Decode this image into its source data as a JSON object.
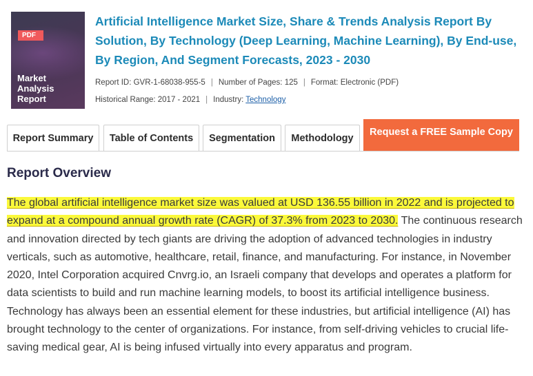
{
  "cover": {
    "badge": "PDF",
    "title_lines": [
      "Market",
      "Analysis",
      "Report"
    ]
  },
  "report": {
    "title": "Artificial Intelligence Market Size, Share & Trends Analysis Report By Solution, By Technology (Deep Learning, Machine Learning), By End-use, By Region, And Segment Forecasts, 2023 - 2030",
    "report_id": "Report ID: GVR-1-68038-955-5",
    "pages": "Number of Pages: 125",
    "format": "Format: Electronic (PDF)",
    "historical_range": "Historical Range: 2017 - 2021",
    "industry_label": "Industry:",
    "industry_link": "Technology",
    "separator": "|"
  },
  "tabs": [
    {
      "label": "Report Summary"
    },
    {
      "label": "Table of Contents"
    },
    {
      "label": "Segmentation"
    },
    {
      "label": "Methodology"
    }
  ],
  "cta": {
    "label": "Request a FREE Sample Copy"
  },
  "overview": {
    "title": "Report Overview",
    "highlight": "The global artificial intelligence market size was valued at USD 136.55 billion in 2022 and is projected to expand at a compound annual growth rate (CAGR) of 37.3% from 2023 to 2030.",
    "rest": " The continuous research and innovation directed by tech giants are driving the adoption of advanced technologies in industry verticals, such as automotive, healthcare, retail, finance, and manufacturing. For instance, in November 2020, Intel Corporation acquired Cnvrg.io, an Israeli company that develops and operates a platform for data scientists to build and run machine learning models, to boost its artificial intelligence business. Technology has always been an essential element for these industries, but artificial intelligence (AI) has brought technology to the center of organizations. For instance, from self-driving vehicles to crucial life-saving medical gear, AI is being infused virtually into every apparatus and program."
  },
  "colors": {
    "title_blue": "#1c8ab8",
    "cta_orange": "#f26a3d",
    "pdf_red": "#f0595b",
    "highlight_yellow": "#fbf93a",
    "cover_purple": "#4a3656"
  }
}
